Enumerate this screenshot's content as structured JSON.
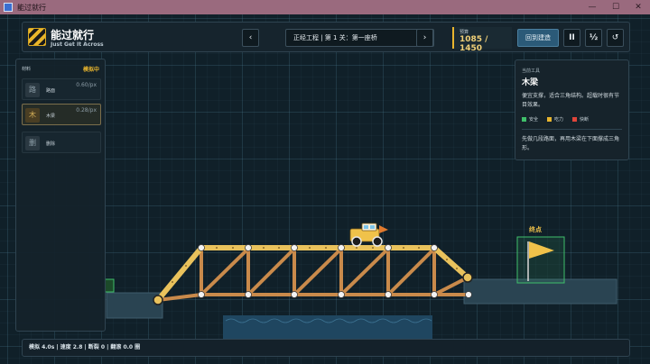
{
  "window": {
    "title": "能过就行",
    "minimize_glyph": "—",
    "maximize_glyph": "☐",
    "close_glyph": "✕"
  },
  "header": {
    "title": "能过就行",
    "subtitle": "Just Get It Across",
    "prev_label": "‹",
    "next_label": "›",
    "level_select": "正经工程 | 第 1 关：第一座桥",
    "budget_label": "预算",
    "budget_value": "1085 / 1450",
    "build_label": "回到建造",
    "pause_label": "II",
    "speed_label": "½",
    "restart_label": "↺"
  },
  "materials_panel": {
    "label": "材料",
    "mode": "模拟中",
    "items": [
      {
        "name": "路面",
        "icon_char": "路",
        "icon": "road-icon",
        "price": "0.60/px",
        "active": false
      },
      {
        "name": "木梁",
        "icon_char": "木",
        "icon": "wood-icon",
        "price": "0.28/px",
        "active": true
      },
      {
        "name": "删除",
        "icon_char": "删",
        "icon": "delete-icon",
        "price": "",
        "active": false
      }
    ]
  },
  "tool_panel": {
    "subtitle": "当前工具",
    "title": "木梁",
    "description": "便宜支撑，适合三角结构。超载时很有节目效果。",
    "legend": [
      {
        "label": "安全",
        "color": "#3fbf6a"
      },
      {
        "label": "吃力",
        "color": "#e8b52e"
      },
      {
        "label": "快断",
        "color": "#e0453a"
      }
    ],
    "hint": "先做几段路面，再用木梁在下面撑成三角形。"
  },
  "goal_label": "终点",
  "status": {
    "text": "模拟 4.0s | 速度 2.8 | 断裂 0 | 翻滚 0.0 圈"
  },
  "colors": {
    "accent": "#e8b52e",
    "beam": "#c98a4b",
    "road": "#e9c25c",
    "goal": "#3fbf6a",
    "water": "#1f4660"
  }
}
